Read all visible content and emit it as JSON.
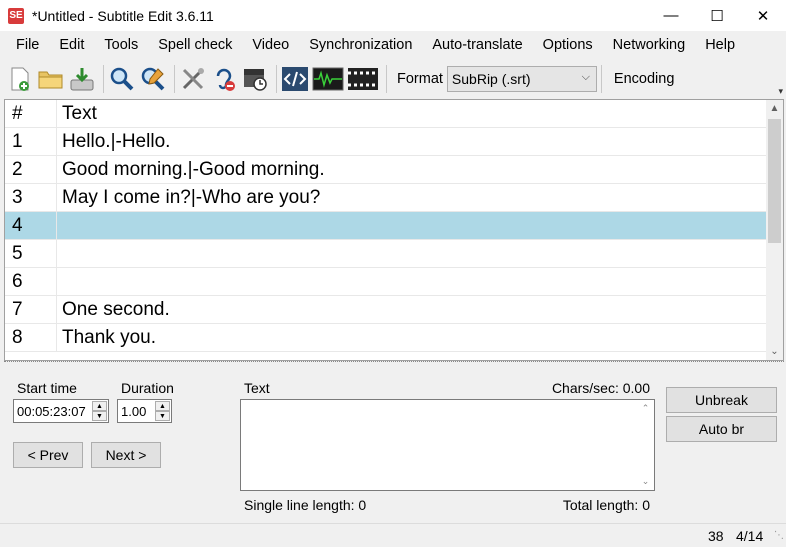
{
  "window": {
    "title": "*Untitled - Subtitle Edit 3.6.11",
    "app_icon_text": "SE",
    "controls": {
      "minimize": "—",
      "maximize": "☐",
      "close": "✕"
    }
  },
  "menu": {
    "items": [
      "File",
      "Edit",
      "Tools",
      "Spell check",
      "Video",
      "Synchronization",
      "Auto-translate",
      "Options",
      "Networking",
      "Help"
    ]
  },
  "toolbar": {
    "icons": [
      "new-file-icon",
      "open-folder-icon",
      "save-download-icon",
      "find-icon",
      "replace-icon",
      "fix-errors-icon",
      "hearing-impaired-icon",
      "visual-sync-icon",
      "source-view-icon",
      "waveform-icon",
      "video-clapper-icon"
    ],
    "format_label": "Format",
    "format_value": "SubRip (.srt)",
    "encoding_label": "Encoding",
    "overflow_glyph": "▾"
  },
  "grid": {
    "headers": {
      "number": "#",
      "text": "Text"
    },
    "rows": [
      {
        "number": "1",
        "text": "Hello.|-Hello."
      },
      {
        "number": "2",
        "text": "Good morning.|-Good morning."
      },
      {
        "number": "3",
        "text": "May I come in?|-Who are you?"
      },
      {
        "number": "4",
        "text": ""
      },
      {
        "number": "5",
        "text": ""
      },
      {
        "number": "6",
        "text": ""
      },
      {
        "number": "7",
        "text": "One second."
      },
      {
        "number": "8",
        "text": "Thank you."
      }
    ],
    "selected_row": 3
  },
  "editor": {
    "start_time_label": "Start time",
    "start_time_value": "00:05:23:07",
    "duration_label": "Duration",
    "duration_value": "1.00",
    "prev_button": "< Prev",
    "next_button": "Next >",
    "text_label": "Text",
    "chars_sec": "Chars/sec: 0.00",
    "single_line_length": "Single line length: 0",
    "total_length": "Total length: 0",
    "unbreak_button": "Unbreak",
    "auto_br_button": "Auto br"
  },
  "status": {
    "char_count": "38",
    "position": "4/14"
  },
  "colors": {
    "selected_row": "#add8e6",
    "app_icon": "#d83b3b"
  }
}
